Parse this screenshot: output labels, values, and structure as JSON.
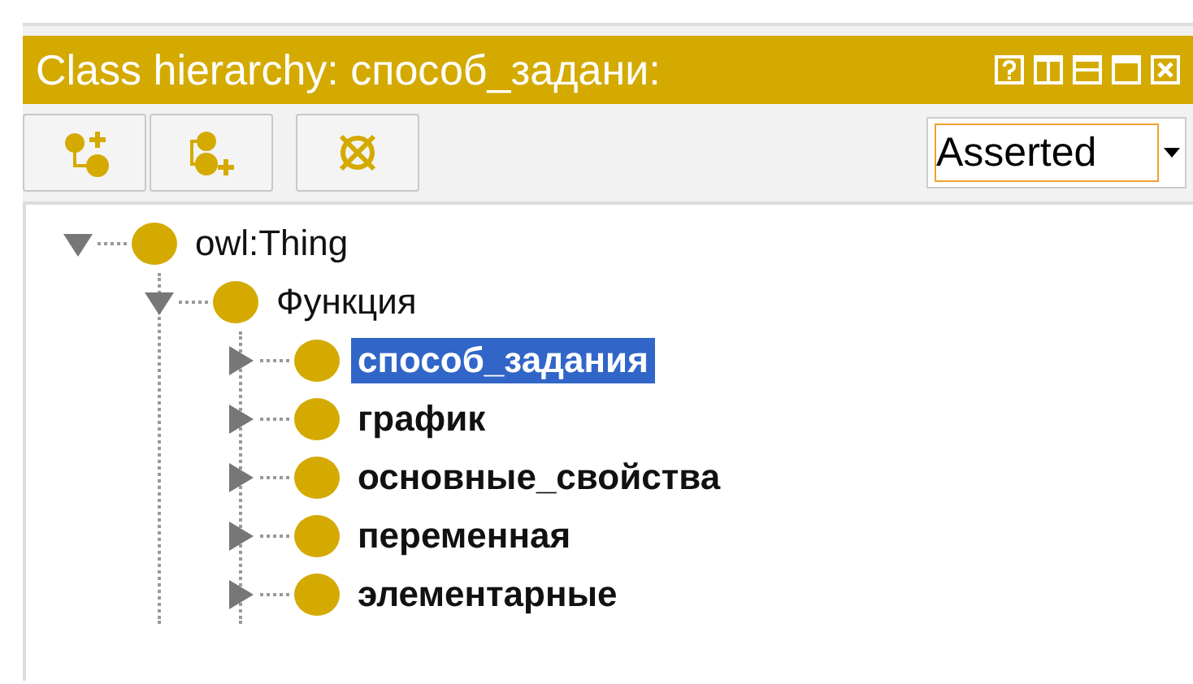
{
  "panel": {
    "title": "Class hierarchy: способ_задани:"
  },
  "toolbar": {
    "buttons": [
      {
        "kind": "add-subclass"
      },
      {
        "kind": "add-sibling"
      },
      {
        "kind": "delete"
      }
    ],
    "view_select": {
      "value": "Asserted"
    }
  },
  "tree": [
    {
      "label": "owl:Thing",
      "expanded": true,
      "selected": false,
      "bold": false,
      "children": [
        {
          "label": "Функция",
          "expanded": true,
          "selected": false,
          "bold": false,
          "children": [
            {
              "label": "способ_задания",
              "expanded": false,
              "selected": true,
              "bold": true
            },
            {
              "label": "график",
              "expanded": false,
              "selected": false,
              "bold": true
            },
            {
              "label": "основные_свойства",
              "expanded": false,
              "selected": false,
              "bold": true
            },
            {
              "label": "переменная",
              "expanded": false,
              "selected": false,
              "bold": true
            },
            {
              "label": "элементарные",
              "expanded": false,
              "selected": false,
              "bold": true
            }
          ]
        }
      ]
    }
  ]
}
